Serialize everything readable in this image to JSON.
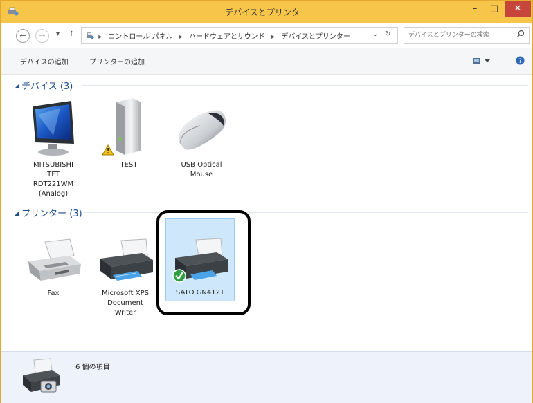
{
  "window": {
    "title": "デバイスとプリンター",
    "controls": {
      "minimize": "–",
      "maximize": "□",
      "close": "✕"
    }
  },
  "navigation": {
    "back": "←",
    "forward": "→",
    "recent": "▾",
    "up": "↑",
    "breadcrumbs": [
      "コントロール パネル",
      "ハードウェアとサウンド",
      "デバイスとプリンター"
    ],
    "separator": "▸",
    "dropdown": "⌄",
    "refresh": "↻",
    "search_placeholder": "デバイスとプリンターの検索"
  },
  "toolbar": {
    "add_device": "デバイスの追加",
    "add_printer": "プリンターの追加",
    "view_icon": "view-icon",
    "help_icon": "help-icon"
  },
  "groups": [
    {
      "header": "デバイス (3)",
      "items": [
        {
          "label": "MITSUBISHI\nTFT\nRDT221WM\n(Analog)",
          "icon": "monitor-icon"
        },
        {
          "label": "TEST",
          "icon": "external-drive-icon",
          "warning": true
        },
        {
          "label": "USB Optical\nMouse",
          "icon": "mouse-icon"
        }
      ]
    },
    {
      "header": "プリンター (3)",
      "items": [
        {
          "label": "Fax",
          "icon": "fax-icon"
        },
        {
          "label": "Microsoft XPS\nDocument\nWriter",
          "icon": "printer-icon"
        },
        {
          "label": "SATO GN412T",
          "icon": "printer-icon",
          "default": true,
          "selected": true
        }
      ]
    }
  ],
  "status": {
    "text": "6 個の項目"
  },
  "colors": {
    "titlebar": "#f6c54a",
    "close": "#c7463b",
    "group_header": "#1e4e8c",
    "selection": "#cfe7fa"
  }
}
